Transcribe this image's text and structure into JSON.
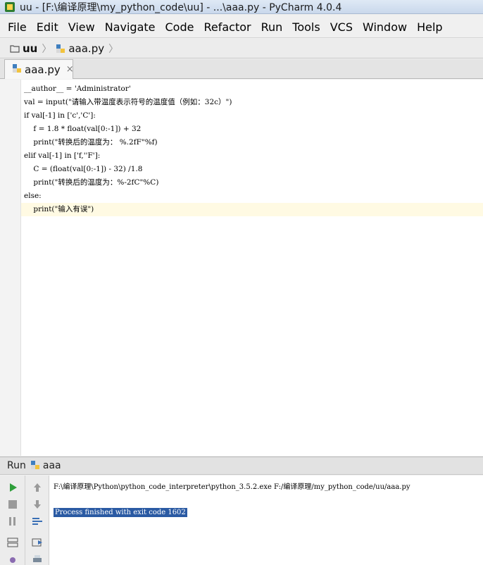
{
  "window": {
    "title": "uu - [F:\\编译原理\\my_python_code\\uu] - ...\\aaa.py - PyCharm 4.0.4"
  },
  "menu": [
    "File",
    "Edit",
    "View",
    "Navigate",
    "Code",
    "Refactor",
    "Run",
    "Tools",
    "VCS",
    "Window",
    "Help"
  ],
  "navbar": {
    "project": "uu",
    "file": "aaa.py"
  },
  "tabs": [
    {
      "label": "aaa.py",
      "close": "×"
    }
  ],
  "editor": {
    "lines": [
      "__author__ = 'Administrator'",
      "val = input(\"请输入带温度表示符号的温度值（例如：32c）\")",
      "if val[-1] in ['c','C']:",
      "    f = 1.8 * float(val[0:-1]) + 32",
      "    print(\"转换后的温度为： %.2fF\"%f)",
      "elif val[-1] in ['f,''F']:",
      "    C = (float(val[0:-1]) - 32) /1.8",
      "    print(\"转换后的温度为：%-2fC\"%C)",
      "else:",
      "    print(\"输入有误\")"
    ]
  },
  "run": {
    "label": "Run",
    "config": "aaa",
    "command": "F:\\编译原理\\Python\\python_code_interpreter\\python_3.5.2.exe F:/编译原理/my_python_code/uu/aaa.py",
    "finished": "Process finished with exit code 1602"
  },
  "colors": {
    "keyword": "#000080",
    "string": "#008000",
    "number": "#0000ff",
    "selection": "#2a5aa3",
    "current_line": "#fffae3"
  }
}
